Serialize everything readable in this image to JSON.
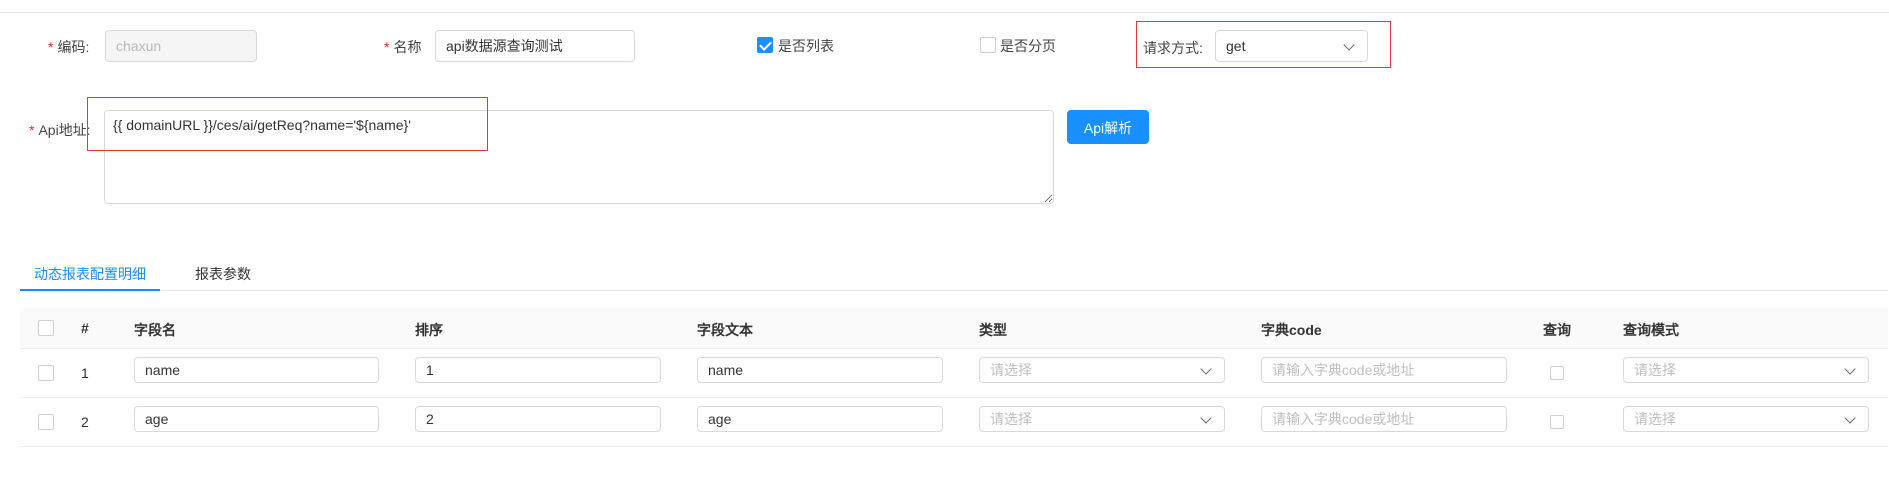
{
  "form": {
    "required_mark": "*",
    "code_label": "编码:",
    "code_value": "chaxun",
    "name_label": "名称",
    "name_value": "api数据源查询测试",
    "is_list_label": "是否列表",
    "is_list_checked": true,
    "is_paged_label": "是否分页",
    "is_paged_checked": false,
    "method_label": "请求方式:",
    "method_value": "get",
    "api_label": "Api地址:",
    "api_value": "{{ domainURL }}/ces/ai/getReq?name='${name}'",
    "api_parse_button": "Api解析"
  },
  "tabs": [
    {
      "label": "动态报表配置明细",
      "active": true
    },
    {
      "label": "报表参数",
      "active": false
    }
  ],
  "table": {
    "columns": [
      "#",
      "字段名",
      "排序",
      "字段文本",
      "类型",
      "字典code",
      "查询",
      "查询模式"
    ],
    "select_placeholder": "请选择",
    "dict_placeholder": "请输入字典code或地址",
    "rows": [
      {
        "index": "1",
        "field_name": "name",
        "order": "1",
        "field_text": "name"
      },
      {
        "index": "2",
        "field_name": "age",
        "order": "2",
        "field_text": "age"
      }
    ]
  },
  "colors": {
    "accent": "#1890ff",
    "required": "#f5222d",
    "highlight_box": "#e53935"
  }
}
